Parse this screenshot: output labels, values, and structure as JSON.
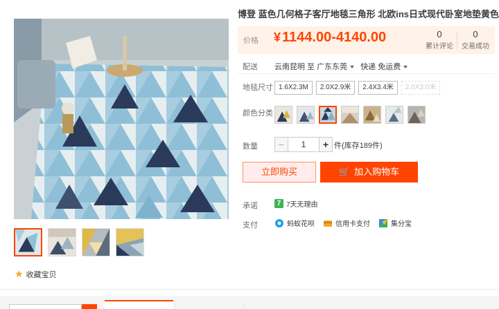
{
  "product": {
    "title": "博登 蓝色几何格子客厅地毯三角形 北欧ins日式现代卧室地垫黄色",
    "price_label": "价格",
    "price_currency": "¥",
    "price_range": "1144.00-4140.00",
    "reviews_count": "0",
    "reviews_label": "累计评论",
    "sales_count": "0",
    "sales_label": "交易成功"
  },
  "shipping": {
    "label": "配送",
    "from": "云南昆明 至",
    "to": "广东东莞",
    "method": "快递 免运费"
  },
  "sizes": {
    "label": "地毯尺寸",
    "options": [
      "1.6X2.3M",
      "2.0X2.9米",
      "2.4X3.4米",
      "2.0X3.0米"
    ],
    "disabled_index": 3
  },
  "colors": {
    "label": "颜色分类",
    "selected_index": 2
  },
  "quantity": {
    "label": "数量",
    "value": "1",
    "minus": "−",
    "plus": "+",
    "stock": "件(库存189件)"
  },
  "actions": {
    "buy_now": "立即购买",
    "add_to_cart": "加入购物车"
  },
  "promise": {
    "label": "承诺",
    "badge": "7",
    "text": "7天无理由"
  },
  "payment": {
    "label": "支付",
    "methods": [
      "蚂蚁花呗",
      "信用卡支付",
      "集分宝"
    ]
  },
  "gallery": {
    "favorite_label": "收藏宝贝",
    "active_thumb": 0
  },
  "colors_theme": {
    "accent": "#ff4400",
    "price_bg": "#fff2e8",
    "rug_blue": "#7fb2cc",
    "rug_navy": "#2b3a5a",
    "rug_light": "#d8e3e6"
  }
}
